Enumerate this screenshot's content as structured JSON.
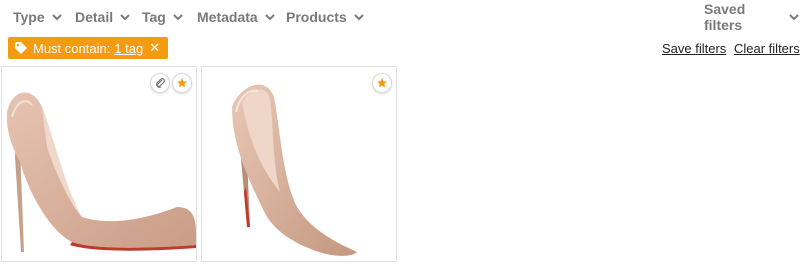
{
  "filters": [
    {
      "label": "Type"
    },
    {
      "label": "Detail"
    },
    {
      "label": "Tag"
    },
    {
      "label": "Metadata"
    },
    {
      "label": "Products"
    }
  ],
  "saved_filters_label": "Saved filters",
  "active_filter": {
    "prefix": "Must contain:",
    "count_label": "1 tag",
    "remove_glyph": "✕",
    "icon": "tag-icon"
  },
  "actions": {
    "save_filters": "Save filters",
    "clear_filters": "Clear filters"
  },
  "colors": {
    "accent": "#f49c10",
    "shoe": "#d9b39f",
    "sole": "#c0392b"
  },
  "assets": [
    {
      "type": "image",
      "subject": "nude patent stiletto pump (side view)",
      "badges": [
        "paperclip-icon",
        "star-icon"
      ]
    },
    {
      "type": "image",
      "subject": "nude patent stiletto pump (angled view)",
      "badges": [
        "star-icon"
      ]
    }
  ]
}
